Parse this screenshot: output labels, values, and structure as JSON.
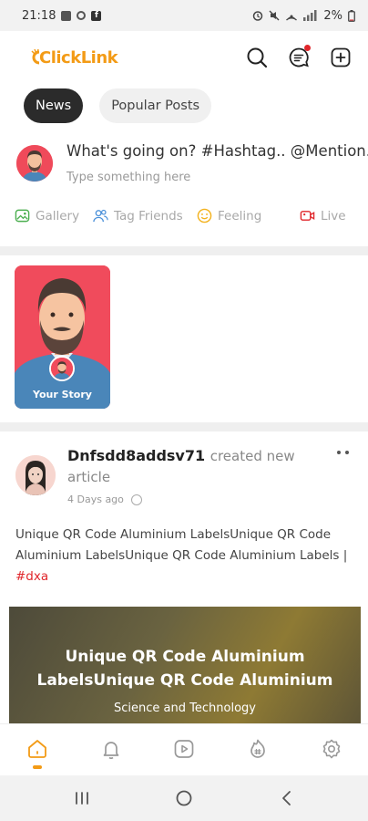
{
  "status_bar": {
    "time": "21:18",
    "battery": "2%"
  },
  "app": {
    "logo_text": "ClickLink",
    "accent_color": "#f39b16",
    "notification_dot_color": "#e0262b"
  },
  "header": {
    "icons": [
      "search-icon",
      "messages-icon",
      "add-post-icon"
    ]
  },
  "tabs": [
    {
      "label": "News",
      "active": true
    },
    {
      "label": "Popular Posts",
      "active": false
    }
  ],
  "composer": {
    "prompt": "What's going on? #Hashtag.. @Mention.",
    "placeholder": "Type something here",
    "actions": [
      {
        "label": "Gallery",
        "icon": "gallery-icon",
        "color": "#4caf50"
      },
      {
        "label": "Tag Friends",
        "icon": "tag-friends-icon",
        "color": "#4a90d9"
      },
      {
        "label": "Feeling",
        "icon": "feeling-icon",
        "color": "#f3b11b"
      },
      {
        "label": "Live",
        "icon": "live-icon",
        "color": "#e0262b"
      }
    ]
  },
  "stories": {
    "your_story_label": "Your Story"
  },
  "post": {
    "author": "Dnfsdd8addsv71",
    "action_line1": "created new",
    "action_line2": "article",
    "time": "4 Days ago",
    "body": "Unique QR Code Aluminium LabelsUnique QR Code Aluminium LabelsUnique QR Code Aluminium Labels |",
    "hashtag": "#dxa",
    "image_title": "Unique QR Code Aluminium LabelsUnique QR Code Aluminium",
    "image_category": "Science and Technology"
  },
  "bottom_nav": {
    "items": [
      "home-icon",
      "notifications-icon",
      "videos-icon",
      "trending-icon",
      "settings-icon"
    ],
    "active": "home-icon"
  },
  "system_nav": {
    "buttons": [
      "recents-button",
      "home-button",
      "back-button"
    ]
  }
}
